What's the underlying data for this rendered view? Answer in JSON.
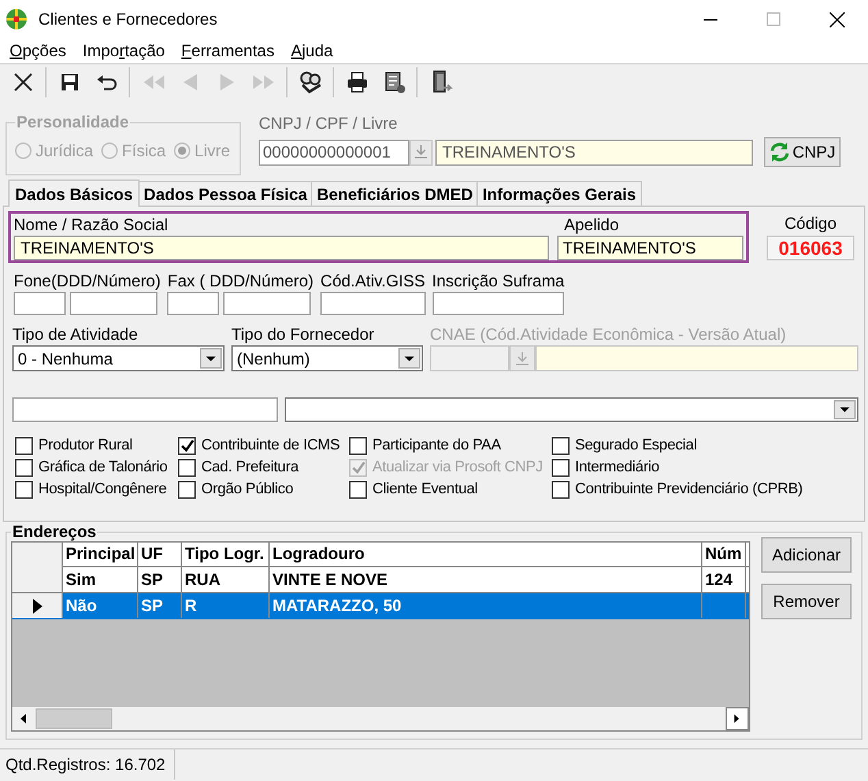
{
  "window": {
    "title": "Clientes e Fornecedores"
  },
  "menu": [
    {
      "key": "O",
      "post": "pções"
    },
    {
      "pre": "Impo",
      "key": "r",
      "post": "tação"
    },
    {
      "key": "F",
      "post": "erramentas"
    },
    {
      "key": "A",
      "post": "juda"
    }
  ],
  "toolbar": [
    {
      "kind": "close",
      "disabled": false
    },
    {
      "kind": "sep"
    },
    {
      "kind": "save",
      "disabled": false
    },
    {
      "kind": "undo",
      "disabled": false
    },
    {
      "kind": "sep"
    },
    {
      "kind": "first",
      "disabled": true
    },
    {
      "kind": "prev",
      "disabled": true
    },
    {
      "kind": "next",
      "disabled": true
    },
    {
      "kind": "last",
      "disabled": true
    },
    {
      "kind": "sep"
    },
    {
      "kind": "search",
      "disabled": false
    },
    {
      "kind": "sep"
    },
    {
      "kind": "print",
      "disabled": false
    },
    {
      "kind": "report",
      "disabled": false
    },
    {
      "kind": "sep"
    },
    {
      "kind": "exit",
      "disabled": false
    }
  ],
  "personalidade": {
    "title": "Personalidade",
    "disabled": true,
    "options": [
      {
        "label": "Jurídica",
        "selected": false
      },
      {
        "label": "Física",
        "selected": false
      },
      {
        "label": "Livre",
        "selected": true
      }
    ]
  },
  "cnpj": {
    "label": "CNPJ / CPF / Livre",
    "value": "00000000000001",
    "name": "TREINAMENTO'S",
    "button": "CNPJ"
  },
  "tabs": [
    {
      "label": "Dados Básicos",
      "selected": true
    },
    {
      "label": "Dados Pessoa Física",
      "selected": false
    },
    {
      "label": "Beneficiários DMED",
      "selected": false
    },
    {
      "label": "Informações Gerais",
      "selected": false
    }
  ],
  "nome": {
    "label": "Nome / Razão Social",
    "value": "TREINAMENTO'S"
  },
  "apelido": {
    "label": "Apelido",
    "value": "TREINAMENTO'S"
  },
  "codigo": {
    "label": "Código",
    "value": "016063"
  },
  "small_fields": [
    {
      "label": "Fone(DDD/Número)",
      "kind": "pair"
    },
    {
      "label": "Fax ( DDD/Número)",
      "kind": "pair"
    },
    {
      "label": "Cód.Ativ.GISS",
      "kind": "single"
    },
    {
      "label": "Inscrição Suframa",
      "kind": "single"
    }
  ],
  "tipo_atividade": {
    "label": "Tipo de Atividade",
    "value": "0 - Nenhuma"
  },
  "tipo_fornecedor": {
    "label": "Tipo do Fornecedor",
    "value": "(Nenhum)"
  },
  "cnae": {
    "label": "CNAE (Cód.Atividade Econômica - Versão Atual)",
    "disabled": true
  },
  "checkbox_columns": [
    [
      {
        "label": "Produtor Rural",
        "checked": false,
        "disabled": false
      },
      {
        "label": "Gráfica de Talonário",
        "checked": false,
        "disabled": false
      },
      {
        "label": "Hospital/Congênere",
        "checked": false,
        "disabled": false
      }
    ],
    [
      {
        "label": "Contribuinte de ICMS",
        "checked": true,
        "disabled": false
      },
      {
        "label": "Cad. Prefeitura",
        "checked": false,
        "disabled": false
      },
      {
        "label": "Orgão Público",
        "checked": false,
        "disabled": false
      }
    ],
    [
      {
        "label": "Participante do PAA",
        "checked": false,
        "disabled": false
      },
      {
        "label": "Atualizar via Prosoft CNPJ",
        "checked": true,
        "disabled": true
      },
      {
        "label": "Cliente Eventual",
        "checked": false,
        "disabled": false
      }
    ],
    [
      {
        "label": "Segurado Especial",
        "checked": false,
        "disabled": false
      },
      {
        "label": "Intermediário",
        "checked": false,
        "disabled": false
      },
      {
        "label": "Contribuinte Previdenciário (CPRB)",
        "checked": false,
        "disabled": false
      }
    ]
  ],
  "enderecos": {
    "title": "Endereços",
    "columns": [
      "Principal",
      "UF",
      "Tipo Logr.",
      "Logradouro",
      "Núm"
    ],
    "rows": [
      {
        "cells": [
          "Sim",
          "SP",
          "RUA",
          "VINTE E NOVE",
          "124"
        ],
        "selected": false
      },
      {
        "cells": [
          "Não",
          "SP",
          "R",
          "MATARAZZO, 50",
          ""
        ],
        "selected": true
      }
    ],
    "buttons": [
      "Adicionar",
      "Remover"
    ]
  },
  "status_bar": {
    "text": "Qtd.Registros: 16.702"
  }
}
